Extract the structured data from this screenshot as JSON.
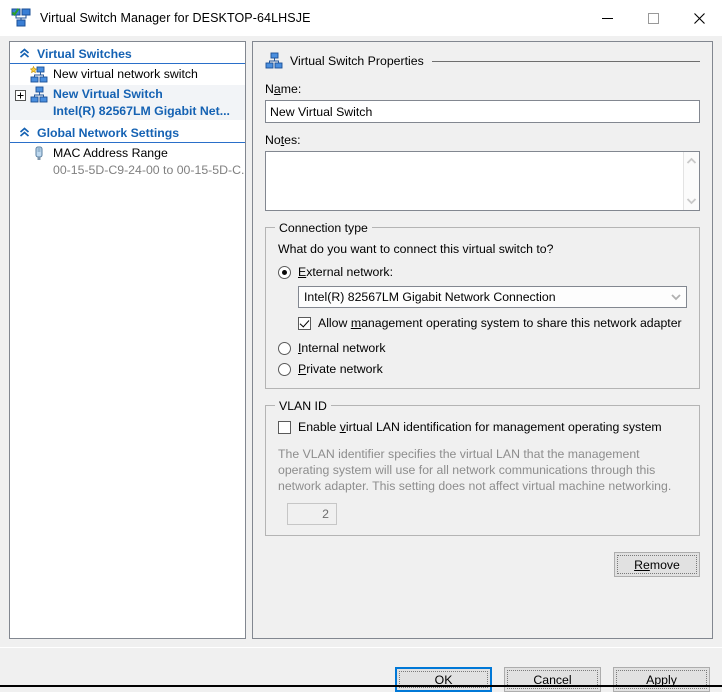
{
  "window": {
    "title": "Virtual Switch Manager for DESKTOP-64LHSJE",
    "icon": "virtual-switch-icon",
    "controls": {
      "minimize": "—",
      "maximize": "□",
      "close": "✕"
    }
  },
  "sidebar": {
    "sections": [
      {
        "label": "Virtual Switches",
        "collapse_icon": "double-chevron-up-icon",
        "items": [
          {
            "label": "New virtual network switch",
            "sublabel": "",
            "icon": "new-virtual-switch-icon",
            "expander": "",
            "selected": false
          },
          {
            "label": "New Virtual Switch",
            "sublabel": "Intel(R) 82567LM Gigabit Net...",
            "icon": "virtual-switch-icon",
            "expander": "plus",
            "selected": true
          }
        ]
      },
      {
        "label": "Global Network Settings",
        "collapse_icon": "double-chevron-up-icon",
        "items": [
          {
            "label": "MAC Address Range",
            "sublabel": "00-15-5D-C9-24-00 to 00-15-5D-C...",
            "icon": "mac-address-icon",
            "expander": "",
            "selected": false
          }
        ]
      }
    ]
  },
  "properties": {
    "group_title": "Virtual Switch Properties",
    "group_icon": "virtual-switch-icon",
    "name_label_pre": "N",
    "name_label_accel": "a",
    "name_label_post": "me:",
    "name_value": "New Virtual Switch",
    "notes_label_pre": "No",
    "notes_label_accel": "t",
    "notes_label_post": "es:",
    "notes_value": "",
    "scroll_up_icon": "chevron-up-icon",
    "scroll_down_icon": "chevron-down-icon"
  },
  "connection_type": {
    "title": "Connection type",
    "question": "What do you want to connect this virtual switch to?",
    "external": {
      "label_pre": "",
      "label_accel": "E",
      "label_post": "xternal network:",
      "selected": true
    },
    "adapter_value": "Intel(R) 82567LM Gigabit Network Connection",
    "adapter_arrow_icon": "chevron-down-icon",
    "allow_management": {
      "label_pre": "Allow ",
      "label_accel": "m",
      "label_post": "anagement operating system to share this network adapter",
      "checked": true
    },
    "internal": {
      "label_pre": "",
      "label_accel": "I",
      "label_post": "nternal network",
      "selected": false
    },
    "private": {
      "label_pre": "",
      "label_accel": "P",
      "label_post": "rivate network",
      "selected": false
    }
  },
  "vlan": {
    "title": "VLAN ID",
    "enable": {
      "label_pre": "Enable ",
      "label_accel": "v",
      "label_post": "irtual LAN identification for management operating system",
      "checked": false
    },
    "description": "The VLAN identifier specifies the virtual LAN that the management operating system will use for all network communications through this network adapter. This setting does not affect virtual machine networking.",
    "id_value": "2"
  },
  "buttons": {
    "remove": {
      "pre": "R",
      "accel": "e",
      "post": "move"
    },
    "ok": {
      "pre": "O",
      "accel": "K",
      "post": ""
    },
    "cancel": {
      "pre": "",
      "accel": "C",
      "post": "ancel"
    },
    "apply": {
      "pre": "",
      "accel": "A",
      "post": "pply"
    }
  },
  "colors": {
    "accent_blue": "#1562b3",
    "default_button_border": "#0078d7",
    "dialog_bg": "#f0f0f0",
    "disabled_text": "#8d8d8d"
  }
}
